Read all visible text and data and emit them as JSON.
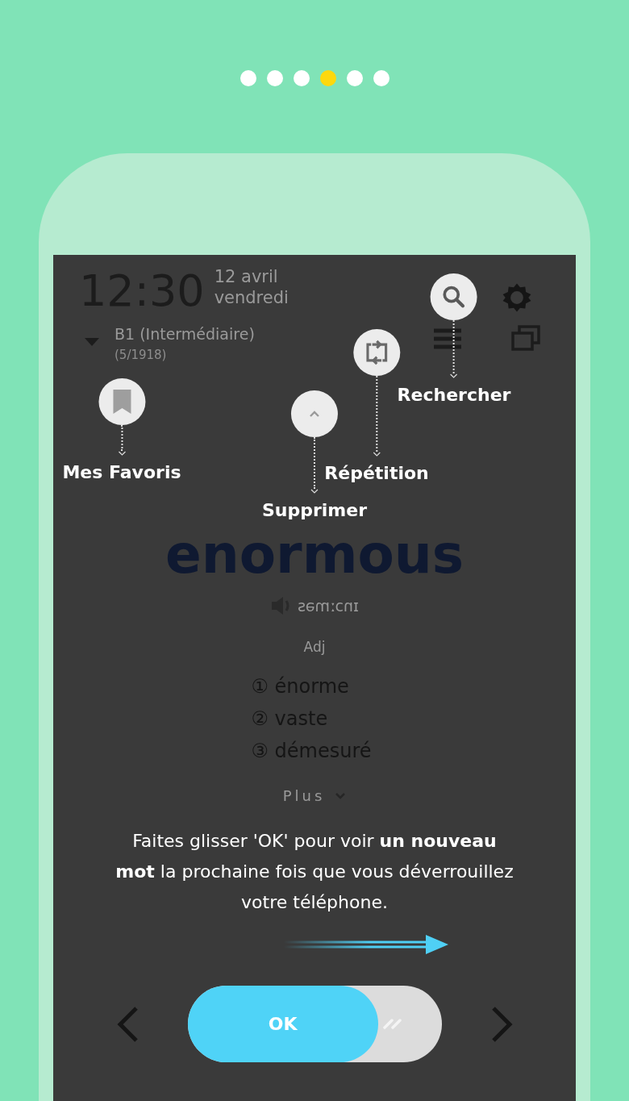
{
  "pager": {
    "dots": [
      {
        "selected": false
      },
      {
        "selected": false
      },
      {
        "selected": false
      },
      {
        "selected": true
      },
      {
        "selected": false
      },
      {
        "selected": false
      }
    ]
  },
  "lock_screen": {
    "time": "12:30",
    "date": "12 avril",
    "weekday": "vendredi",
    "level_name": "B1 (Intermédiaire)",
    "progress": "(5/1918)",
    "word": "enormous",
    "pronunciation": "ɪnɔːməs",
    "part_of_speech": "Adj",
    "meanings": [
      "① énorme",
      "② vaste",
      "③ démesuré"
    ],
    "more_button": "Plus"
  },
  "callouts": [
    {
      "kind": "search",
      "label": "Rechercher"
    },
    {
      "kind": "repeat",
      "label": "Répétition"
    },
    {
      "kind": "up",
      "label": "Supprimer"
    },
    {
      "kind": "bookmark",
      "label": "Mes Favoris"
    }
  ],
  "tutorial": {
    "text": "Faites glisser 'OK' pour voir **un nouveau mot** la prochaine fois que vous déverrouillez votre téléphone."
  },
  "slider": {
    "label": "OK",
    "level": 0.75
  }
}
